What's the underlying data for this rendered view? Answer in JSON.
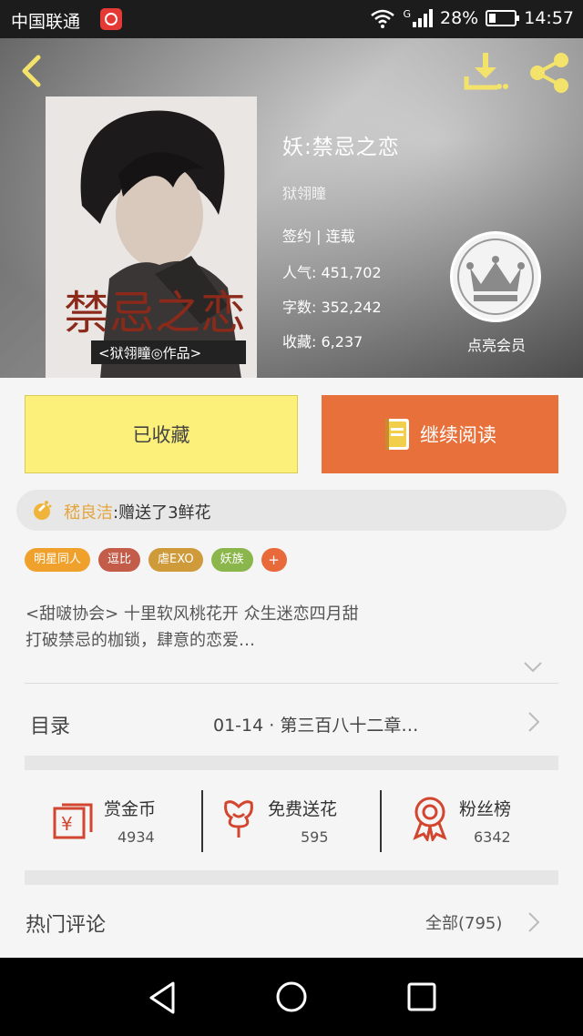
{
  "status_bar": {
    "carrier": "中国联通",
    "battery": "28%",
    "time": "14:57",
    "network": "G"
  },
  "book": {
    "title": "妖:禁忌之恋",
    "author": "狱翎瞳",
    "status": "签约 | 连载",
    "popularity_label": "人气:",
    "popularity": "451,702",
    "wordcount_label": "字数:",
    "wordcount": "352,242",
    "favorites_label": "收藏:",
    "favorites": "6,237",
    "cover_title": "禁忌之恋",
    "cover_credit": "<狱翎瞳◎作品>"
  },
  "vip": {
    "label": "点亮会员"
  },
  "actions": {
    "collected": "已收藏",
    "continue_read": "继续阅读"
  },
  "gift": {
    "user": "嵇良洁",
    "message": ":赠送了3鲜花"
  },
  "tags": [
    {
      "label": "明星同人",
      "color": "#f0a12c"
    },
    {
      "label": "逗比",
      "color": "#c45c4a"
    },
    {
      "label": "虐EXO",
      "color": "#cf9a3a"
    },
    {
      "label": "妖族",
      "color": "#8ab64c"
    },
    {
      "label": "+",
      "color": "#e8693a"
    }
  ],
  "description": {
    "line1": "<甜啵协会>  十里软风桃花开 众生迷恋四月甜",
    "line2": "打破禁忌的枷锁，肆意的恋爱…"
  },
  "toc": {
    "label": "目录",
    "latest": "01-14 · 第三百八十二章…"
  },
  "stats": [
    {
      "label": "赏金币",
      "value": "4934"
    },
    {
      "label": "免费送花",
      "value": "595"
    },
    {
      "label": "粉丝榜",
      "value": "6342"
    }
  ],
  "comments": {
    "title": "热门评论",
    "all": "全部(795)"
  },
  "colors": {
    "accent_orange": "#e8703a",
    "collect_yellow": "#fcf07a",
    "icon_red": "#d2452f",
    "icon_gold": "#f4e36b"
  }
}
